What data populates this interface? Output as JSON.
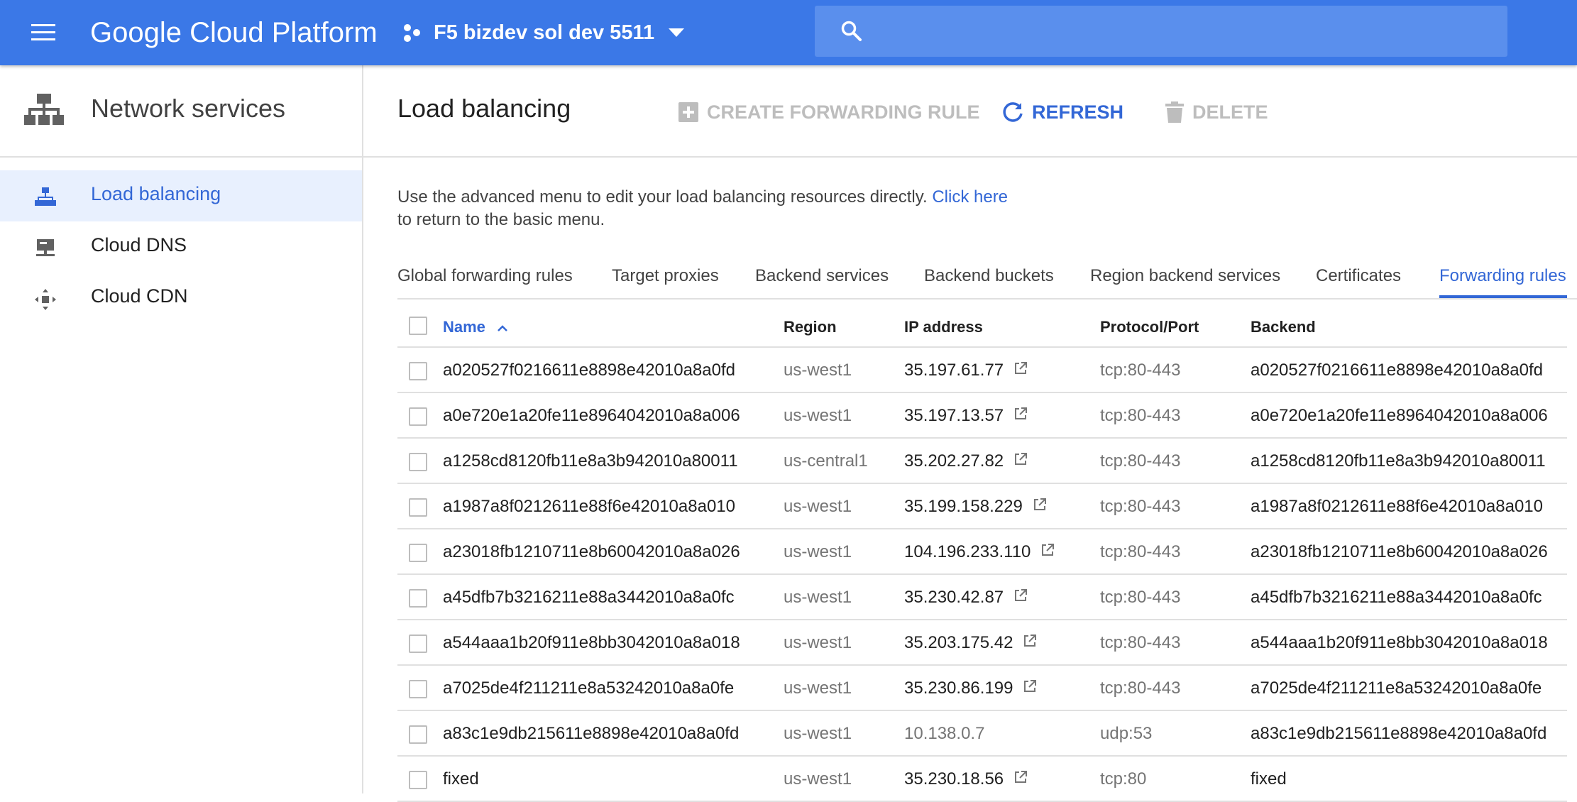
{
  "topbar": {
    "brand": "Google Cloud Platform",
    "project_name": "F5 bizdev sol dev 5511",
    "search_placeholder": "",
    "colors": {
      "bar": "#3b78e7",
      "search": "#5a8fed"
    },
    "icons": [
      "menu-icon",
      "project-icon",
      "chevron-down-icon",
      "search-icon"
    ]
  },
  "sidebar": {
    "title": "Network services",
    "items": [
      {
        "label": "Load balancing",
        "icon": "load-balancing-icon",
        "active": true
      },
      {
        "label": "Cloud DNS",
        "icon": "cloud-dns-icon",
        "active": false
      },
      {
        "label": "Cloud CDN",
        "icon": "cloud-cdn-icon",
        "active": false
      }
    ]
  },
  "main": {
    "title": "Load balancing",
    "actions": {
      "create": "CREATE FORWARDING RULE",
      "refresh": "REFRESH",
      "delete": "DELETE"
    },
    "info": {
      "line1": "Use the advanced menu to edit your load balancing resources directly.",
      "link": "Click here",
      "line2": "to return to the basic menu."
    },
    "tabs": [
      "Global forwarding rules",
      "Target proxies",
      "Backend services",
      "Backend buckets",
      "Region backend services",
      "Certificates",
      "Forwarding rules"
    ],
    "active_tab": "Forwarding rules",
    "accent_color": "#3367d6"
  },
  "table": {
    "headers": {
      "name": "Name",
      "region": "Region",
      "ip": "IP address",
      "protocol": "Protocol/Port",
      "backend": "Backend"
    },
    "sort": {
      "column": "Name",
      "direction": "ascending"
    },
    "rows": [
      {
        "name": "a020527f0216611e8898e42010a8a0fd",
        "region": "us-west1",
        "ip": "35.197.61.77",
        "external": true,
        "protocol": "tcp:80-443",
        "backend": "a020527f0216611e8898e42010a8a0fd"
      },
      {
        "name": "a0e720e1a20fe11e8964042010a8a006",
        "region": "us-west1",
        "ip": "35.197.13.57",
        "external": true,
        "protocol": "tcp:80-443",
        "backend": "a0e720e1a20fe11e8964042010a8a006"
      },
      {
        "name": "a1258cd8120fb11e8a3b942010a80011",
        "region": "us-central1",
        "ip": "35.202.27.82",
        "external": true,
        "protocol": "tcp:80-443",
        "backend": "a1258cd8120fb11e8a3b942010a80011"
      },
      {
        "name": "a1987a8f0212611e88f6e42010a8a010",
        "region": "us-west1",
        "ip": "35.199.158.229",
        "external": true,
        "protocol": "tcp:80-443",
        "backend": "a1987a8f0212611e88f6e42010a8a010"
      },
      {
        "name": "a23018fb1210711e8b60042010a8a026",
        "region": "us-west1",
        "ip": "104.196.233.110",
        "external": true,
        "protocol": "tcp:80-443",
        "backend": "a23018fb1210711e8b60042010a8a026"
      },
      {
        "name": "a45dfb7b3216211e88a3442010a8a0fc",
        "region": "us-west1",
        "ip": "35.230.42.87",
        "external": true,
        "protocol": "tcp:80-443",
        "backend": "a45dfb7b3216211e88a3442010a8a0fc"
      },
      {
        "name": "a544aaa1b20f911e8bb3042010a8a018",
        "region": "us-west1",
        "ip": "35.203.175.42",
        "external": true,
        "protocol": "tcp:80-443",
        "backend": "a544aaa1b20f911e8bb3042010a8a018"
      },
      {
        "name": "a7025de4f211211e8a53242010a8a0fe",
        "region": "us-west1",
        "ip": "35.230.86.199",
        "external": true,
        "protocol": "tcp:80-443",
        "backend": "a7025de4f211211e8a53242010a8a0fe"
      },
      {
        "name": "a83c1e9db215611e8898e42010a8a0fd",
        "region": "us-west1",
        "ip": "10.138.0.7",
        "external": false,
        "protocol": "udp:53",
        "backend": "a83c1e9db215611e8898e42010a8a0fd"
      },
      {
        "name": "fixed",
        "region": "us-west1",
        "ip": "35.230.18.56",
        "external": true,
        "protocol": "tcp:80",
        "backend": "fixed"
      }
    ]
  }
}
